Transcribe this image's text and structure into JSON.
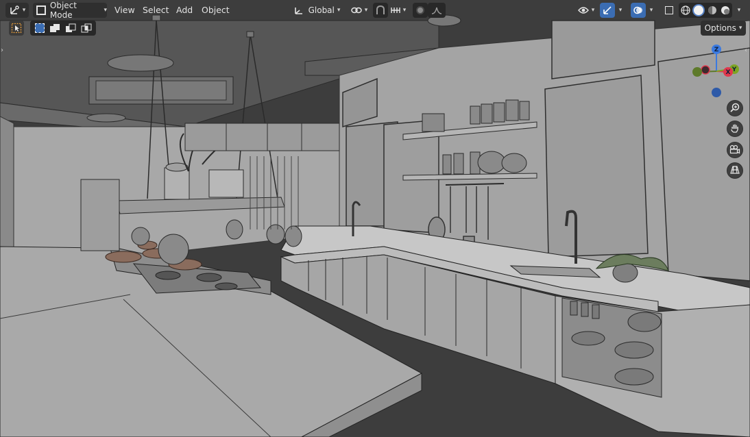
{
  "header": {
    "mode_label": "Object Mode",
    "menus": [
      "View",
      "Select",
      "Add",
      "Object"
    ],
    "transform_orientation": "Global",
    "options_label": "Options"
  },
  "gizmo": {
    "axes": {
      "z": "Z",
      "x": "X",
      "y": "Y"
    }
  },
  "colors": {
    "accent_blue": "#3b6db3",
    "header_bg": "#2b2b2b",
    "axis_x": "#e0384d",
    "axis_y": "#7da522",
    "axis_z": "#3b7ae0",
    "scene_wall": "#a7a7a7",
    "scene_ceiling": "#545454"
  },
  "icons": {
    "editor_type": "transform-gizmo-icon",
    "select_tool": "select-box-icon",
    "select_modes": [
      "select-new-icon",
      "select-extend-icon",
      "select-subtract-icon",
      "select-intersect-icon"
    ],
    "navigate": [
      "zoom-icon",
      "hand-pan-icon",
      "camera-view-icon",
      "ortho-grid-icon"
    ],
    "shading": [
      "wireframe-shading-icon",
      "solid-shading-icon",
      "material-preview-icon",
      "rendered-shading-icon"
    ]
  }
}
